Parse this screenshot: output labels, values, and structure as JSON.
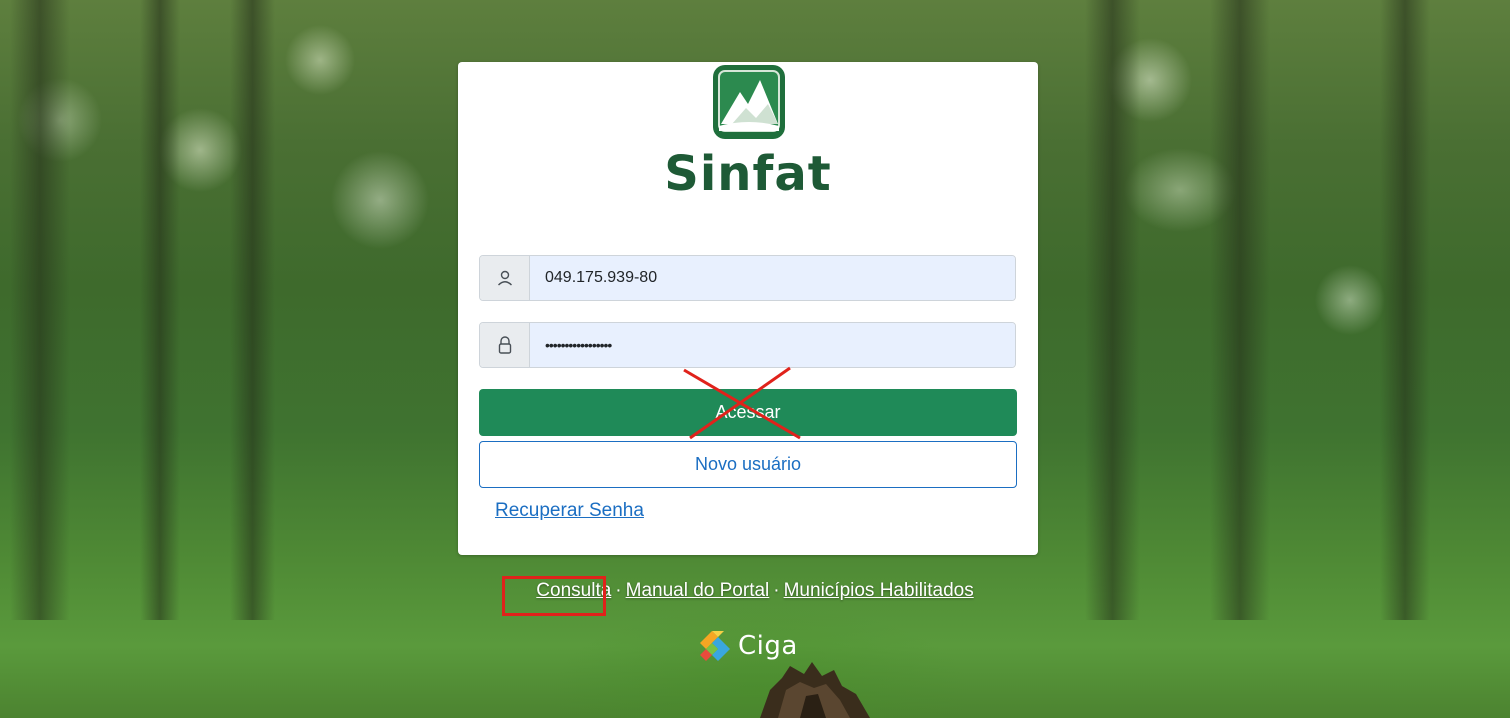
{
  "brand": {
    "name": "Sinfat",
    "color": "#1e5a36",
    "badge_color": "#1f6f3c"
  },
  "login": {
    "user_icon": "user-icon",
    "user_value": "049.175.939-80",
    "password_icon": "lock-icon",
    "password_value": "•••••••••••••••••",
    "submit_label": "Acessar",
    "new_user_label": "Novo usuário",
    "recover_label": "Recuperar Senha"
  },
  "footer": {
    "links": [
      "Consulta",
      "Manual do Portal",
      "Municípios Habilitados"
    ],
    "separator": "·",
    "partner": "Ciga"
  },
  "annotations": {
    "cross_color": "#e0221b",
    "highlight_color": "#e0221b"
  },
  "colors": {
    "primary_button": "#1f8a58",
    "outline_button": "#1b6ec2",
    "input_bg": "#e8f0fe"
  }
}
